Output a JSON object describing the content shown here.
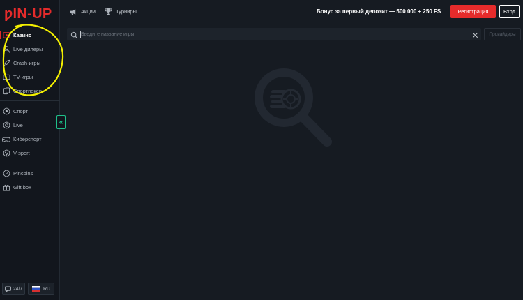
{
  "brand": {
    "logo_text": "PIN-UP",
    "color": "#e52b2b"
  },
  "header": {
    "links": [
      {
        "label": "Акции",
        "icon": "megaphone-icon"
      },
      {
        "label": "Турниры",
        "icon": "trophy-icon"
      }
    ],
    "bonus_text": "Бонус за первый депозит — 500 000 + 250 FS",
    "register_label": "Регистрация",
    "login_label": "Вход"
  },
  "sidebar": {
    "groups": [
      [
        {
          "label": "Казино",
          "icon": "casino-icon",
          "active": true
        },
        {
          "label": "Live дилеры",
          "icon": "dealer-icon"
        },
        {
          "label": "Crash-игры",
          "icon": "rocket-icon"
        },
        {
          "label": "TV-игры",
          "icon": "tv-icon"
        },
        {
          "label": "Спортпокер",
          "icon": "sportpoker-icon"
        }
      ],
      [
        {
          "label": "Спорт",
          "icon": "soccer-ball-icon"
        },
        {
          "label": "Live",
          "icon": "live-icon"
        },
        {
          "label": "Киберспорт",
          "icon": "gamepad-icon"
        },
        {
          "label": "V-sport",
          "icon": "vsport-icon"
        }
      ],
      [
        {
          "label": "Pincoins",
          "icon": "coin-icon"
        },
        {
          "label": "Gift box",
          "icon": "gift-icon"
        }
      ]
    ],
    "support_label": "24/7",
    "language_label": "RU"
  },
  "search": {
    "placeholder": "Введите название игры",
    "value": "",
    "providers_label": "Провайдеры"
  },
  "colors": {
    "accent": "#e52b2b",
    "collapse_accent": "#1fc08a",
    "background": "#161b22",
    "annotation": "#f4f000"
  }
}
